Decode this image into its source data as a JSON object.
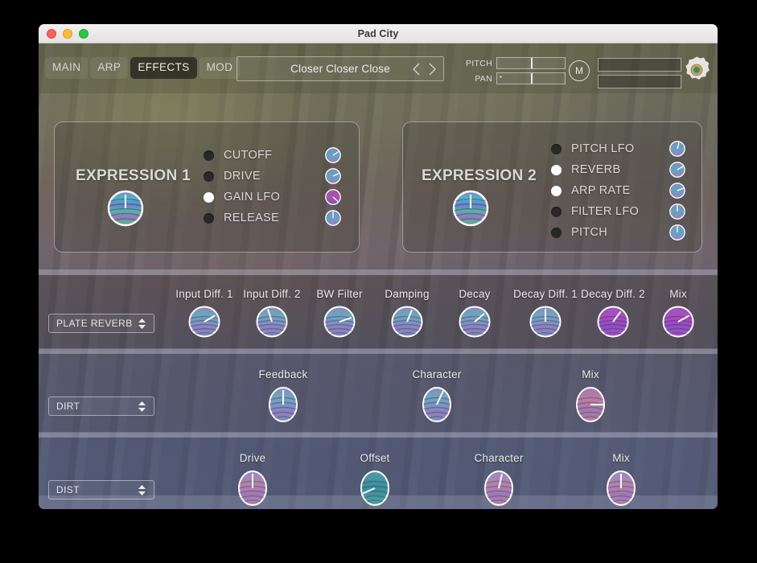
{
  "window": {
    "title": "Pad City",
    "traffic_lights": [
      "close",
      "minimize",
      "zoom"
    ]
  },
  "toolbar": {
    "tabs": [
      {
        "label": "MAIN",
        "active": false
      },
      {
        "label": "ARP",
        "active": false
      },
      {
        "label": "EFFECTS",
        "active": true
      },
      {
        "label": "MOD",
        "active": false
      }
    ],
    "preset": {
      "name": "Closer Closer Close",
      "prev_icon": "chevron-left-icon",
      "next_icon": "chevron-right-icon"
    },
    "pitch": {
      "label": "PITCH",
      "value_pct": 50
    },
    "pan": {
      "label": "PAN",
      "value_pct": 50
    },
    "mono_button": {
      "label": "M"
    },
    "meters": [
      {
        "level_pct": 0
      },
      {
        "level_pct": 0
      }
    ],
    "settings_icon": "gear-icon"
  },
  "expression_1": {
    "title": "EXPRESSION 1",
    "macro_knob": {
      "angle_deg": 0,
      "hue": "teal-purple"
    },
    "destinations": [
      {
        "label": "CUTOFF",
        "enabled": false,
        "knob_angle_deg": 52,
        "hue": "teal-purple"
      },
      {
        "label": "DRIVE",
        "enabled": false,
        "knob_angle_deg": 58,
        "hue": "teal-purple"
      },
      {
        "label": "GAIN LFO",
        "enabled": true,
        "knob_angle_deg": 128,
        "hue": "magenta"
      },
      {
        "label": "RELEASE",
        "enabled": false,
        "knob_angle_deg": 0,
        "hue": "teal-purple"
      }
    ]
  },
  "expression_2": {
    "title": "EXPRESSION 2",
    "macro_knob": {
      "angle_deg": 0,
      "hue": "teal-purple"
    },
    "destinations": [
      {
        "label": "PITCH LFO",
        "enabled": false,
        "knob_angle_deg": 14,
        "hue": "teal-purple"
      },
      {
        "label": "REVERB",
        "enabled": true,
        "knob_angle_deg": 62,
        "hue": "teal-purple"
      },
      {
        "label": "ARP RATE",
        "enabled": true,
        "knob_angle_deg": 72,
        "hue": "teal-purple"
      },
      {
        "label": "FILTER LFO",
        "enabled": false,
        "knob_angle_deg": 0,
        "hue": "teal-purple"
      },
      {
        "label": "PITCH",
        "enabled": false,
        "knob_angle_deg": 0,
        "hue": "teal-purple"
      }
    ]
  },
  "effects": [
    {
      "slot": "reverb",
      "selected": "PLATE REVERB",
      "params": [
        {
          "label": "Input Diff. 1",
          "angle_deg": 60,
          "hue": "teal-purple"
        },
        {
          "label": "Input Diff. 2",
          "angle_deg": -18,
          "hue": "teal-purple"
        },
        {
          "label": "BW Filter",
          "angle_deg": 72,
          "hue": "teal-purple"
        },
        {
          "label": "Damping",
          "angle_deg": 22,
          "hue": "teal-purple"
        },
        {
          "label": "Decay",
          "angle_deg": 50,
          "hue": "teal-purple"
        },
        {
          "label": "Decay Diff. 1",
          "angle_deg": 0,
          "hue": "teal-purple"
        },
        {
          "label": "Decay Diff. 2",
          "angle_deg": 36,
          "hue": "magenta"
        },
        {
          "label": "Mix",
          "angle_deg": 62,
          "hue": "magenta"
        }
      ]
    },
    {
      "slot": "dirt",
      "selected": "DIRT",
      "params": [
        {
          "label": "Feedback",
          "angle_deg": 0,
          "hue": "teal-purple"
        },
        {
          "label": "Character",
          "angle_deg": 26,
          "hue": "teal-purple"
        },
        {
          "label": "Mix",
          "angle_deg": 90,
          "hue": "magenta"
        }
      ]
    },
    {
      "slot": "dist",
      "selected": "DIST",
      "params": [
        {
          "label": "Drive",
          "angle_deg": 0,
          "hue": "magenta"
        },
        {
          "label": "Offset",
          "angle_deg": -112,
          "hue": "teal"
        },
        {
          "label": "Character",
          "angle_deg": 14,
          "hue": "magenta"
        },
        {
          "label": "Mix",
          "angle_deg": 0,
          "hue": "magenta"
        }
      ]
    }
  ],
  "colors": {
    "accent_magenta": "#a05bc0",
    "accent_teal": "#4ea8b4",
    "panel_border": "#ffffff",
    "text_primary": "#e6e6e4"
  }
}
